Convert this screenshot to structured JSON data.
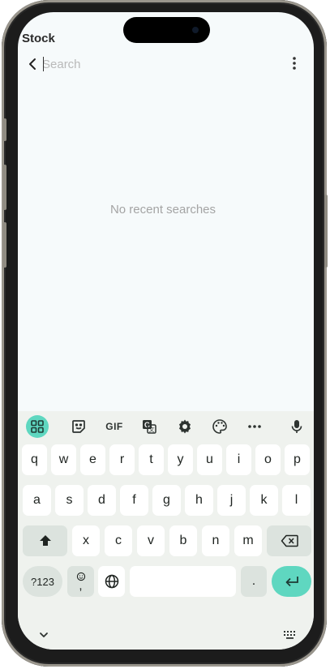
{
  "app": {
    "title": "Stock"
  },
  "search": {
    "placeholder": "Search",
    "value": ""
  },
  "icons": {
    "back": "back-arrow-icon",
    "more": "more-vertical-icon"
  },
  "empty_state": {
    "message": "No recent searches"
  },
  "keyboard": {
    "toolbar": {
      "gif_label": "GIF",
      "items": [
        "apps-grid-icon",
        "sticker-icon",
        "gif",
        "translate-icon",
        "settings-icon",
        "palette-icon",
        "more-horizontal-icon",
        "mic-icon"
      ]
    },
    "row1": [
      "q",
      "w",
      "e",
      "r",
      "t",
      "y",
      "u",
      "i",
      "o",
      "p"
    ],
    "row2": [
      "a",
      "s",
      "d",
      "f",
      "g",
      "h",
      "j",
      "k",
      "l"
    ],
    "row3": [
      "x",
      "c",
      "v",
      "b",
      "n",
      "m"
    ],
    "symbols_label": "?123",
    "emoji_comma_label": ",",
    "period_label": ".",
    "accent_color": "#5fd7c0"
  }
}
